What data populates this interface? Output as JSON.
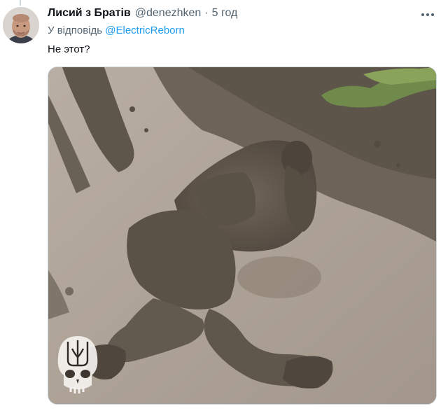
{
  "tweet": {
    "display_name": "Лисий з Братів",
    "handle": "@denezhken",
    "separator": "·",
    "time": "5 год",
    "reply_prefix": "У відповідь",
    "reply_to": "@ElectricReborn",
    "text": "Не этот?"
  },
  "icons": {
    "more": "more-horizontal-icon",
    "watermark": "trident-skull-icon"
  },
  "colors": {
    "text_primary": "#0f1419",
    "text_secondary": "#536471",
    "link": "#1d9bf0",
    "border": "#cfd9de"
  }
}
